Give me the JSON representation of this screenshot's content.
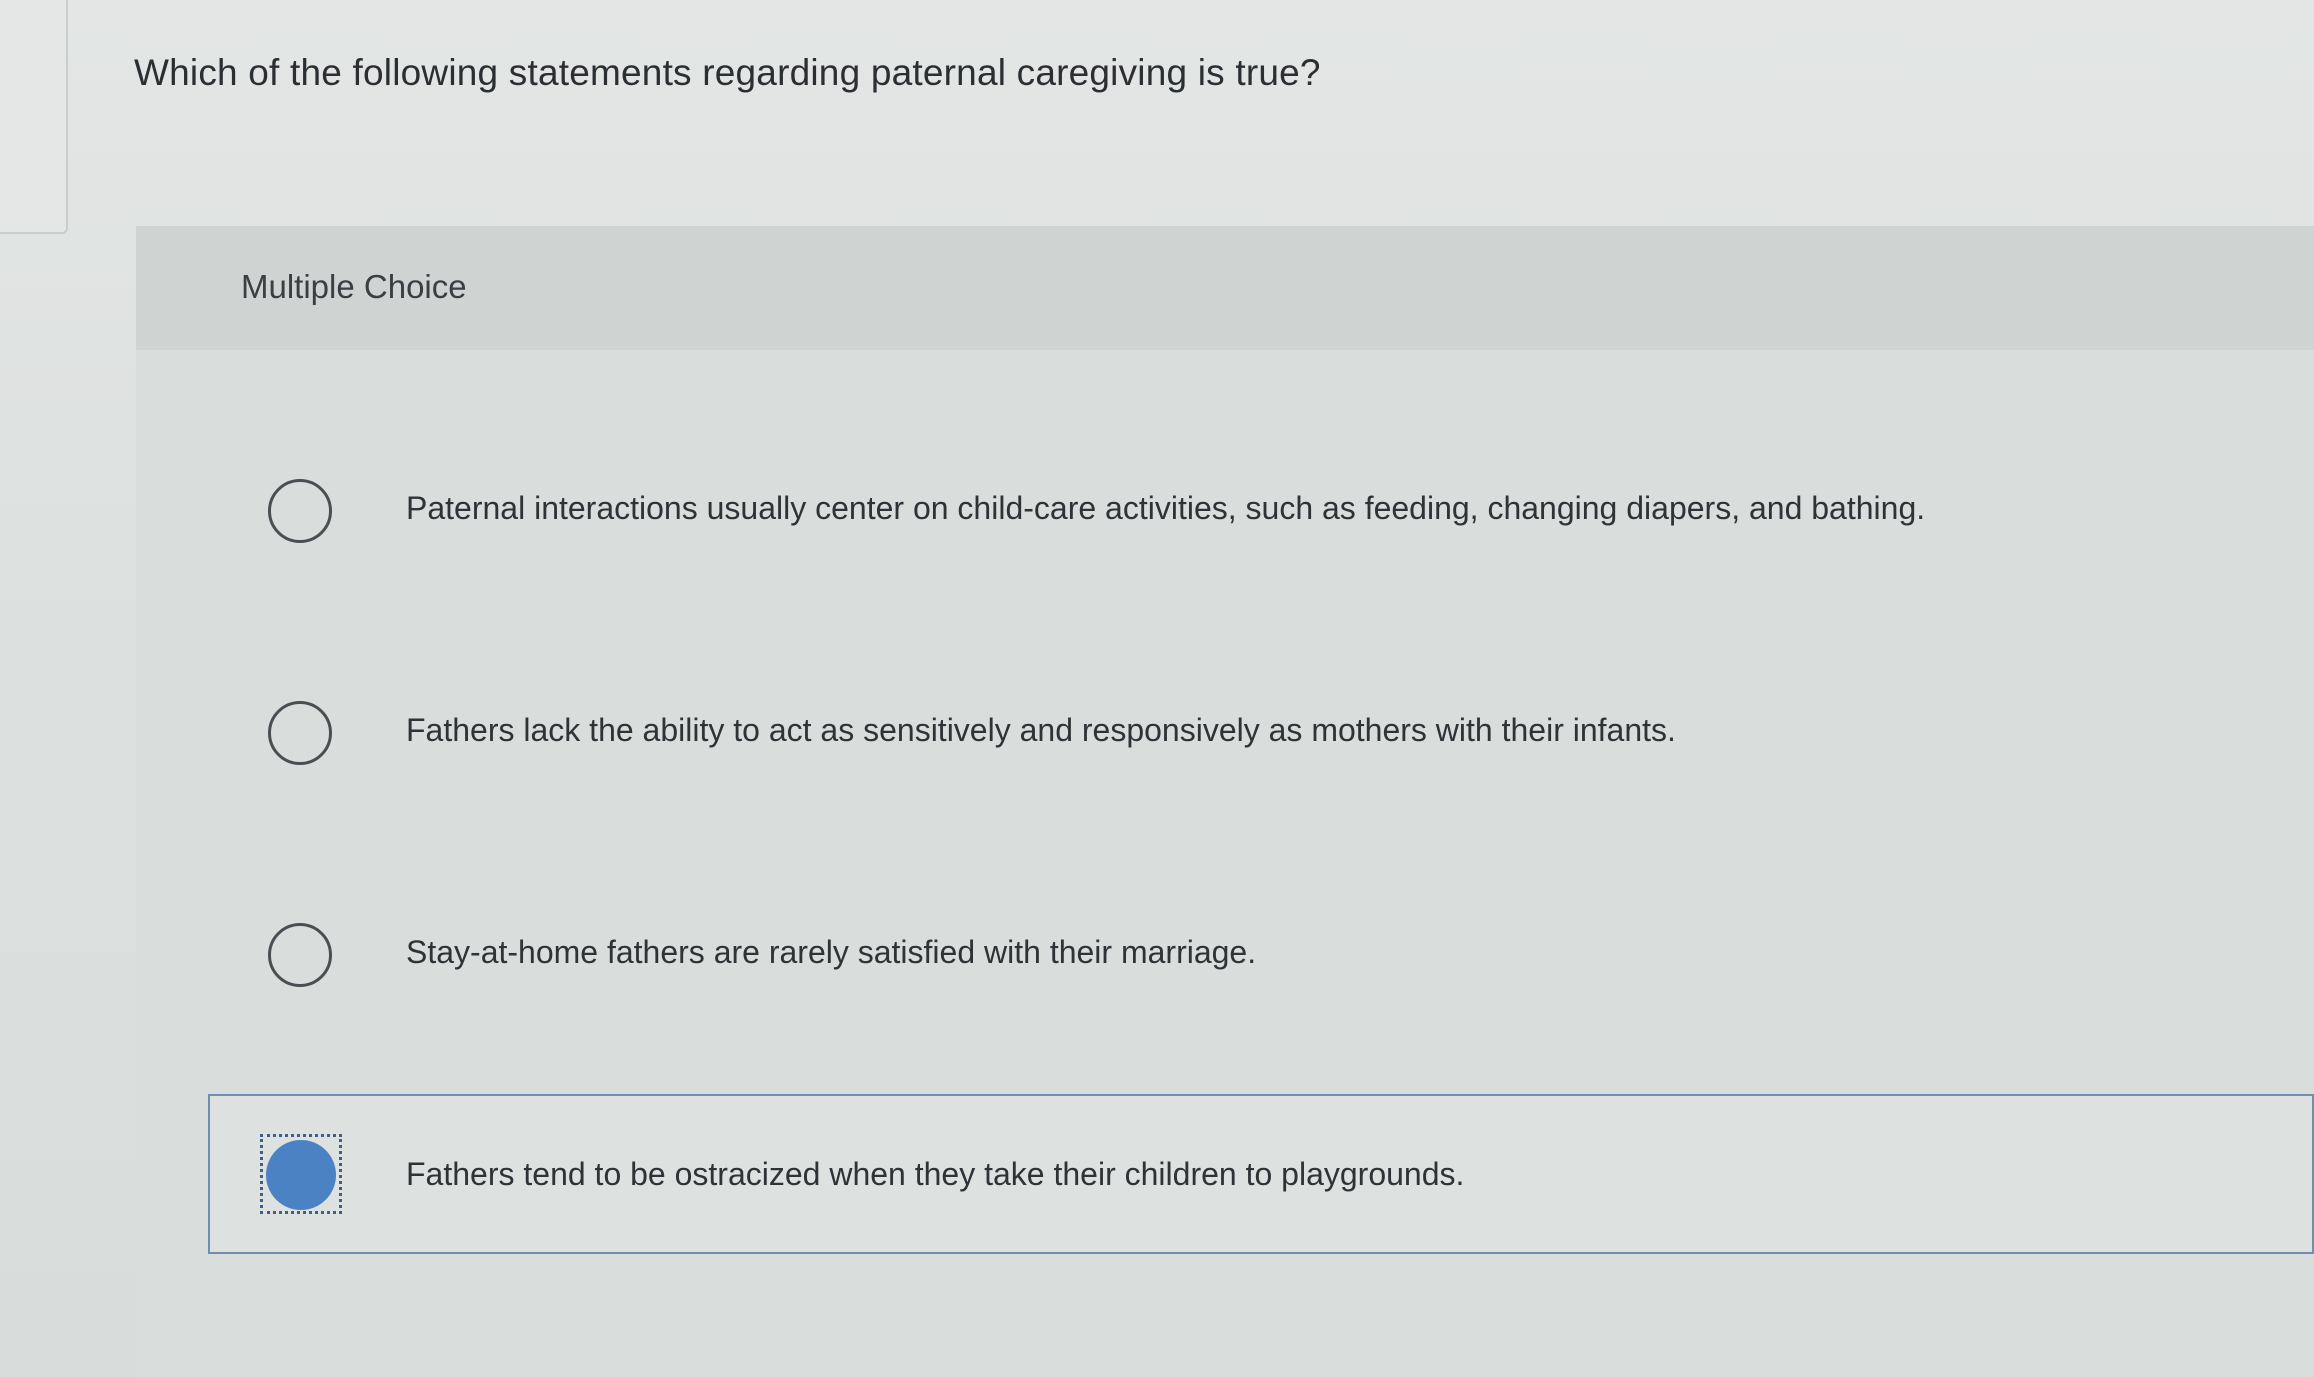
{
  "question": {
    "text": "Which of the following statements regarding paternal caregiving is true?"
  },
  "card": {
    "type_label": "Multiple Choice"
  },
  "options": [
    {
      "label": "Paternal interactions usually center on child-care activities, such as feeding, changing diapers, and bathing.",
      "selected": false
    },
    {
      "label": "Fathers lack the ability to act as sensitively and responsively as mothers with their infants.",
      "selected": false
    },
    {
      "label": "Stay-at-home fathers are rarely satisfied with their marriage.",
      "selected": false
    },
    {
      "label": "Fathers tend to be ostracized when they take their children to playgrounds.",
      "selected": true
    }
  ],
  "colors": {
    "selected_radio": "#4a82c4",
    "selected_border": "#6f8fb0",
    "background": "#dfe2e0"
  }
}
